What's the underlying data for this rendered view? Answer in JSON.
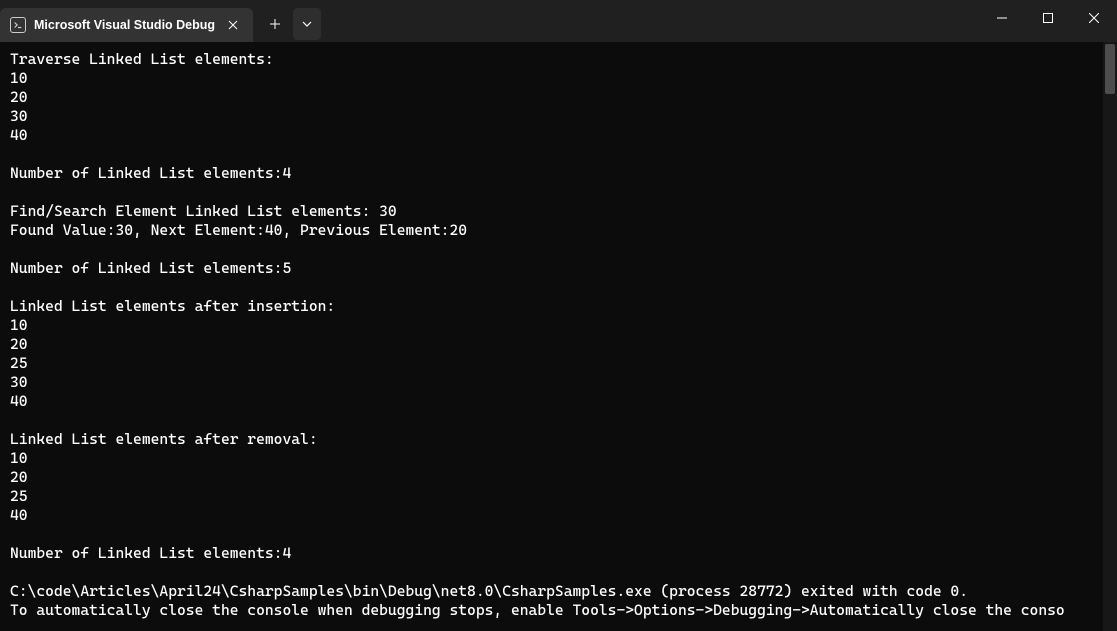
{
  "tab": {
    "title": "Microsoft Visual Studio Debug"
  },
  "console": {
    "lines": [
      "Traverse Linked List elements:",
      "10",
      "20",
      "30",
      "40",
      "",
      "Number of Linked List elements:4",
      "",
      "Find/Search Element Linked List elements: 30",
      "Found Value:30, Next Element:40, Previous Element:20",
      "",
      "Number of Linked List elements:5",
      "",
      "Linked List elements after insertion:",
      "10",
      "20",
      "25",
      "30",
      "40",
      "",
      "Linked List elements after removal:",
      "10",
      "20",
      "25",
      "40",
      "",
      "Number of Linked List elements:4",
      "",
      "C:\\code\\Articles\\April24\\CsharpSamples\\bin\\Debug\\net8.0\\CsharpSamples.exe (process 28772) exited with code 0.",
      "To automatically close the console when debugging stops, enable Tools->Options->Debugging->Automatically close the conso"
    ]
  }
}
